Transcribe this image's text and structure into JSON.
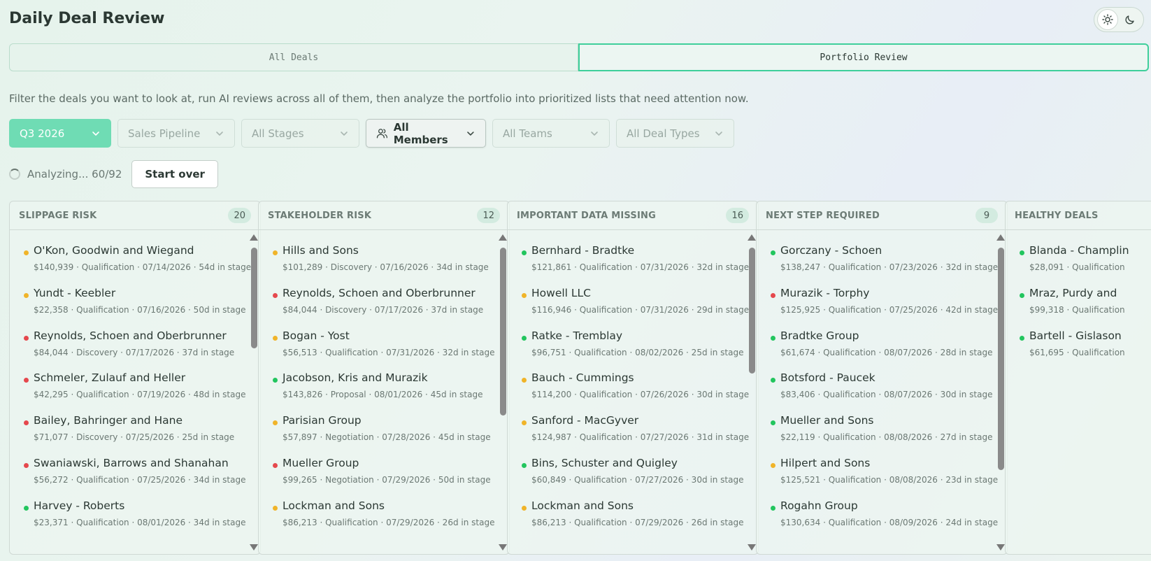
{
  "header": {
    "title": "Daily Deal Review"
  },
  "theme_toggle": {
    "light_icon": "sun-icon",
    "dark_icon": "moon-icon"
  },
  "tabs": [
    {
      "label": "All Deals",
      "active": false
    },
    {
      "label": "Portfolio Review",
      "active": true
    }
  ],
  "description": "Filter the deals you want to look at, run AI reviews across all of them, then analyze the portfolio into prioritized lists that need attention now.",
  "filters": {
    "quarter": "Q3 2026",
    "pipeline": "Sales Pipeline",
    "stages": "All Stages",
    "members": "All Members",
    "teams": "All Teams",
    "deal_types": "All Deal Types"
  },
  "status": {
    "text": "Analyzing... 60/92",
    "start_over": "Start over"
  },
  "colors": {
    "red": "#e5484d",
    "yellow": "#f0b429",
    "green": "#22c55e",
    "accent": "#6fdcb4"
  },
  "columns": [
    {
      "title": "SLIPPAGE RISK",
      "count": "20",
      "deals": [
        {
          "name": "O'Kon, Goodwin and Wiegand",
          "meta": "$140,939 · Qualification · 07/14/2026 · 54d in stage",
          "status": "yellow"
        },
        {
          "name": "Yundt - Keebler",
          "meta": "$22,358 · Qualification · 07/16/2026 · 50d in stage",
          "status": "yellow"
        },
        {
          "name": "Reynolds, Schoen and Oberbrunner",
          "meta": "$84,044 · Discovery · 07/17/2026 · 37d in stage",
          "status": "red"
        },
        {
          "name": "Schmeler, Zulauf and Heller",
          "meta": "$42,295 · Qualification · 07/19/2026 · 48d in stage",
          "status": "red"
        },
        {
          "name": "Bailey, Bahringer and Hane",
          "meta": "$71,077 · Discovery · 07/25/2026 · 25d in stage",
          "status": "red"
        },
        {
          "name": "Swaniawski, Barrows and Shanahan",
          "meta": "$56,272 · Qualification · 07/25/2026 · 34d in stage",
          "status": "red"
        },
        {
          "name": "Harvey - Roberts",
          "meta": "$23,371 · Qualification · 08/01/2026 · 34d in stage",
          "status": "green"
        }
      ]
    },
    {
      "title": "STAKEHOLDER RISK",
      "count": "12",
      "deals": [
        {
          "name": "Hills and Sons",
          "meta": "$101,289 · Discovery · 07/16/2026 · 34d in stage",
          "status": "yellow"
        },
        {
          "name": "Reynolds, Schoen and Oberbrunner",
          "meta": "$84,044 · Discovery · 07/17/2026 · 37d in stage",
          "status": "red"
        },
        {
          "name": "Bogan - Yost",
          "meta": "$56,513 · Qualification · 07/31/2026 · 32d in stage",
          "status": "yellow"
        },
        {
          "name": "Jacobson, Kris and Murazik",
          "meta": "$143,826 · Proposal · 08/01/2026 · 45d in stage",
          "status": "green"
        },
        {
          "name": "Parisian Group",
          "meta": "$57,897 · Negotiation · 07/28/2026 · 45d in stage",
          "status": "yellow"
        },
        {
          "name": "Mueller Group",
          "meta": "$99,265 · Negotiation · 07/29/2026 · 50d in stage",
          "status": "red"
        },
        {
          "name": "Lockman and Sons",
          "meta": "$86,213 · Qualification · 07/29/2026 · 26d in stage",
          "status": "yellow"
        }
      ]
    },
    {
      "title": "IMPORTANT DATA MISSING",
      "count": "16",
      "deals": [
        {
          "name": "Bernhard - Bradtke",
          "meta": "$121,861 · Qualification · 07/31/2026 · 32d in stage",
          "status": "green"
        },
        {
          "name": "Howell LLC",
          "meta": "$116,946 · Qualification · 07/31/2026 · 29d in stage",
          "status": "yellow"
        },
        {
          "name": "Ratke - Tremblay",
          "meta": "$96,751 · Qualification · 08/02/2026 · 25d in stage",
          "status": "green"
        },
        {
          "name": "Bauch - Cummings",
          "meta": "$114,200 · Qualification · 07/26/2026 · 30d in stage",
          "status": "yellow"
        },
        {
          "name": "Sanford - MacGyver",
          "meta": "$124,987 · Qualification · 07/27/2026 · 31d in stage",
          "status": "yellow"
        },
        {
          "name": "Bins, Schuster and Quigley",
          "meta": "$60,849 · Qualification · 07/27/2026 · 30d in stage",
          "status": "green"
        },
        {
          "name": "Lockman and Sons",
          "meta": "$86,213 · Qualification · 07/29/2026 · 26d in stage",
          "status": "yellow"
        }
      ]
    },
    {
      "title": "NEXT STEP REQUIRED",
      "count": "9",
      "deals": [
        {
          "name": "Gorczany - Schoen",
          "meta": "$138,247 · Qualification · 07/23/2026 · 32d in stage",
          "status": "green"
        },
        {
          "name": "Murazik - Torphy",
          "meta": "$125,925 · Qualification · 07/25/2026 · 42d in stage",
          "status": "red"
        },
        {
          "name": "Bradtke Group",
          "meta": "$61,674 · Qualification · 08/07/2026 · 28d in stage",
          "status": "green"
        },
        {
          "name": "Botsford - Paucek",
          "meta": "$83,406 · Qualification · 08/07/2026 · 30d in stage",
          "status": "green"
        },
        {
          "name": "Mueller and Sons",
          "meta": "$22,119 · Qualification · 08/08/2026 · 27d in stage",
          "status": "green"
        },
        {
          "name": "Hilpert and Sons",
          "meta": "$125,521 · Qualification · 08/08/2026 · 23d in stage",
          "status": "yellow"
        },
        {
          "name": "Rogahn Group",
          "meta": "$130,634 · Qualification · 08/09/2026 · 24d in stage",
          "status": "green"
        }
      ]
    },
    {
      "title": "HEALTHY DEALS",
      "count": "",
      "deals": [
        {
          "name": "Blanda - Champlin",
          "meta": "$28,091 · Qualification",
          "status": "green"
        },
        {
          "name": "Mraz, Purdy and",
          "meta": "$99,318 · Qualification",
          "status": "green"
        },
        {
          "name": "Bartell - Gislason",
          "meta": "$61,695 · Qualification",
          "status": "green"
        }
      ]
    }
  ]
}
